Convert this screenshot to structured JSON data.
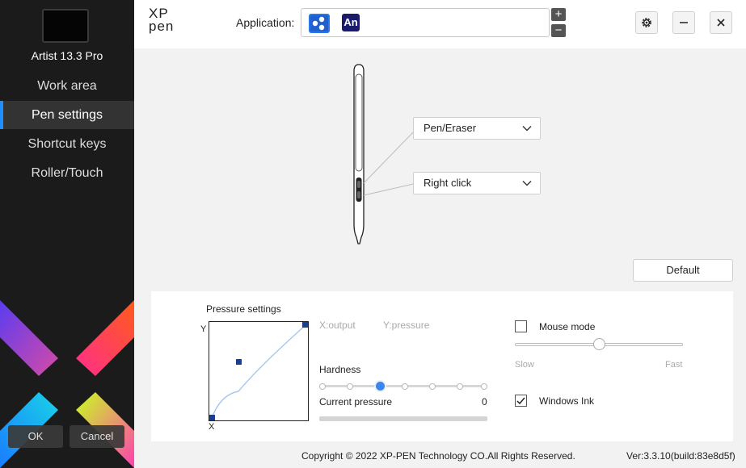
{
  "sidebar": {
    "device_name": "Artist 13.3 Pro",
    "nav": [
      {
        "label": "Work area"
      },
      {
        "label": "Pen settings"
      },
      {
        "label": "Shortcut keys"
      },
      {
        "label": "Roller/Touch"
      }
    ],
    "ok_label": "OK",
    "cancel_label": "Cancel"
  },
  "header": {
    "logo_top": "XP",
    "logo_bottom": "pen",
    "application_label": "Application:",
    "app_icons": [
      "all-apps-icon",
      "animate-icon"
    ],
    "app2_text": "An",
    "add_label": "+",
    "remove_label": "−"
  },
  "pen": {
    "upper_button": "Pen/Eraser",
    "lower_button": "Right click",
    "default_label": "Default"
  },
  "pressure": {
    "title": "Pressure settings",
    "y_axis": "Y",
    "x_axis": "X",
    "x_output": "X:output",
    "y_pressure": "Y:pressure",
    "hardness_label": "Hardness",
    "hardness_level": 0.35,
    "current_pressure_label": "Current pressure",
    "current_pressure_value": "0"
  },
  "mouse_mode": {
    "label": "Mouse mode",
    "checked": false,
    "slow": "Slow",
    "fast": "Fast",
    "level": 0.5
  },
  "windows_ink": {
    "label": "Windows Ink",
    "checked": true
  },
  "footer": {
    "copyright": "Copyright © 2022  XP-PEN Technology CO.All Rights Reserved.",
    "version": "Ver:3.3.10(build:83e8d5f)"
  },
  "colors": {
    "accent": "#3a86f0",
    "sidebar_bg": "#1b1b1b",
    "active_indicator": "#1e8fff"
  }
}
